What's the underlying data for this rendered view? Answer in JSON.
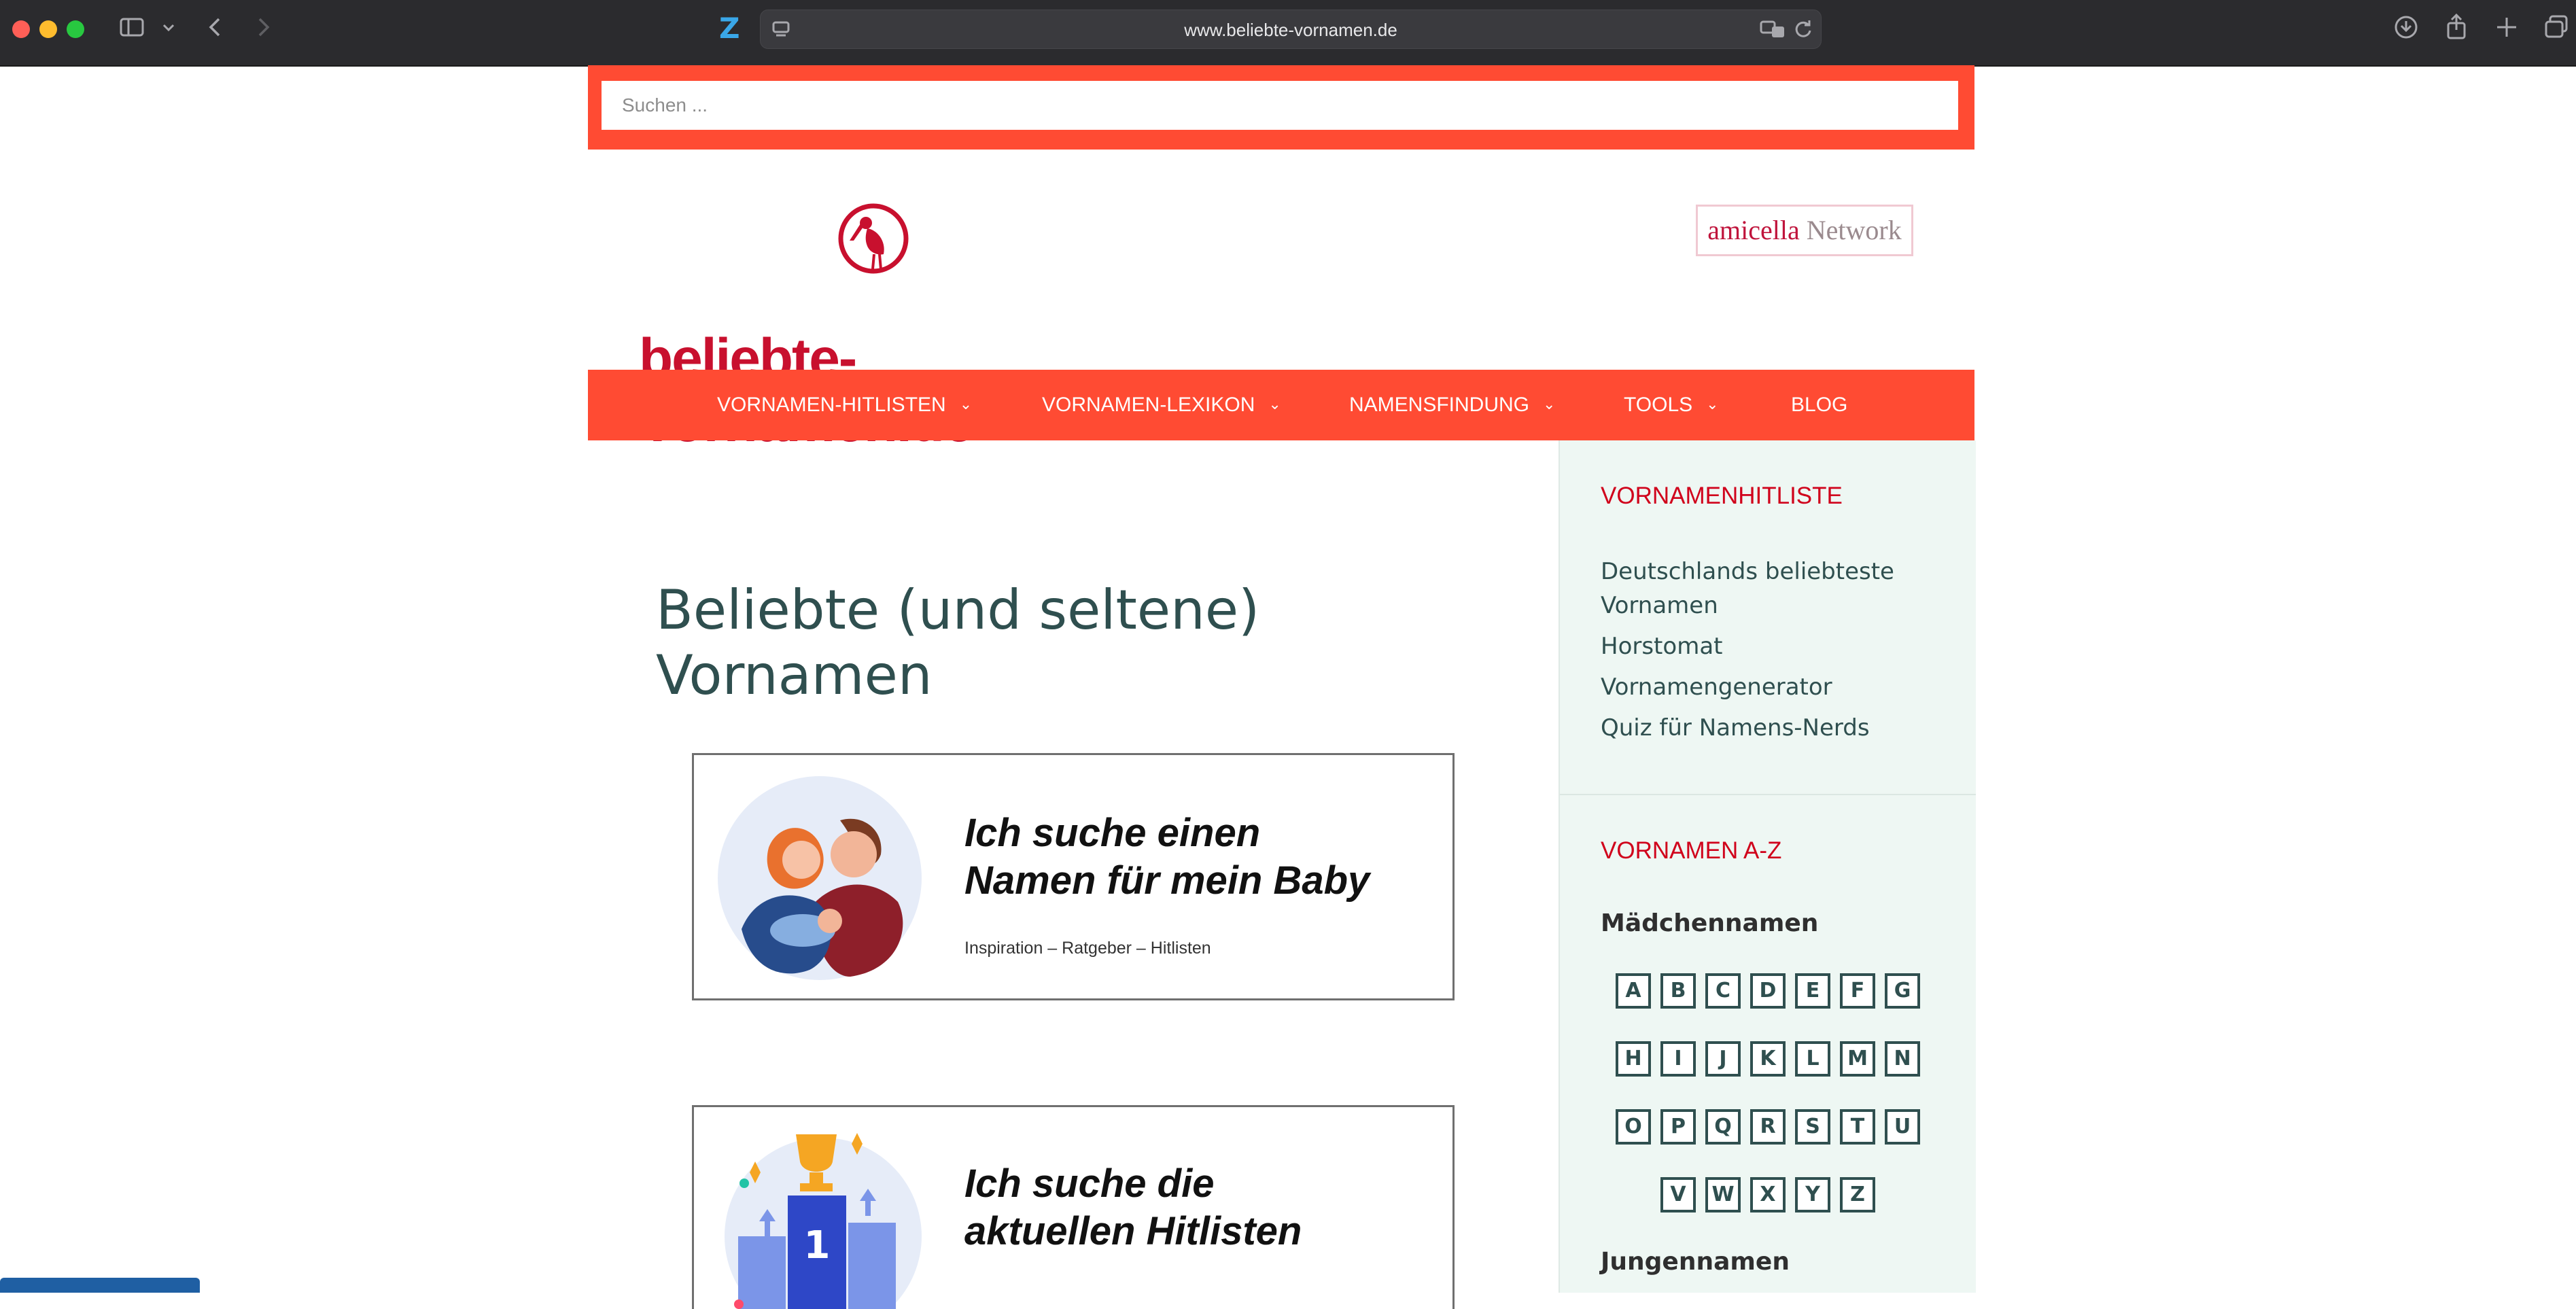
{
  "browser": {
    "url": "www.beliebte-vornamen.de"
  },
  "search": {
    "placeholder": "Suchen ..."
  },
  "header": {
    "logo_text": "beliebte-Vornamen.de",
    "network_part1": "amicella",
    "network_part2": "Network"
  },
  "nav": {
    "items": [
      {
        "label": "VORNAMEN-HITLISTEN",
        "has_dropdown": true
      },
      {
        "label": "VORNAMEN-LEXIKON",
        "has_dropdown": true
      },
      {
        "label": "NAMENSFINDUNG",
        "has_dropdown": true
      },
      {
        "label": "TOOLS",
        "has_dropdown": true
      },
      {
        "label": "BLOG",
        "has_dropdown": false
      }
    ]
  },
  "main": {
    "title": "Beliebte (und seltene) Vornamen",
    "banners": [
      {
        "heading_line1": "Ich suche einen",
        "heading_line2": "Namen für mein Baby",
        "subtitle": "Inspiration – Ratgeber – Hitlisten"
      },
      {
        "heading_line1": "Ich suche die",
        "heading_line2": "aktuellen Hitlisten",
        "podium_number": "1"
      }
    ]
  },
  "sidebar": {
    "section1_title": "VORNAMENHITLISTE",
    "section1_links": [
      "Deutschlands beliebteste Vornamen",
      "Horstomat",
      "Vornamengenerator",
      "Quiz für Namens-Nerds"
    ],
    "section2_title": "VORNAMEN A-Z",
    "girls_title": "Mädchennamen",
    "letter_rows": [
      [
        "A",
        "B",
        "C",
        "D",
        "E",
        "F",
        "G"
      ],
      [
        "H",
        "I",
        "J",
        "K",
        "L",
        "M",
        "N"
      ],
      [
        "O",
        "P",
        "Q",
        "R",
        "S",
        "T",
        "U"
      ],
      [
        "V",
        "W",
        "X",
        "Y",
        "Z"
      ]
    ],
    "boys_title": "Jungennamen"
  },
  "colors": {
    "brand_red": "#ff4b33",
    "logo_red": "#c8102e",
    "text_dark": "#2f4f4f",
    "sidebar_bg": "#eef7f3"
  }
}
